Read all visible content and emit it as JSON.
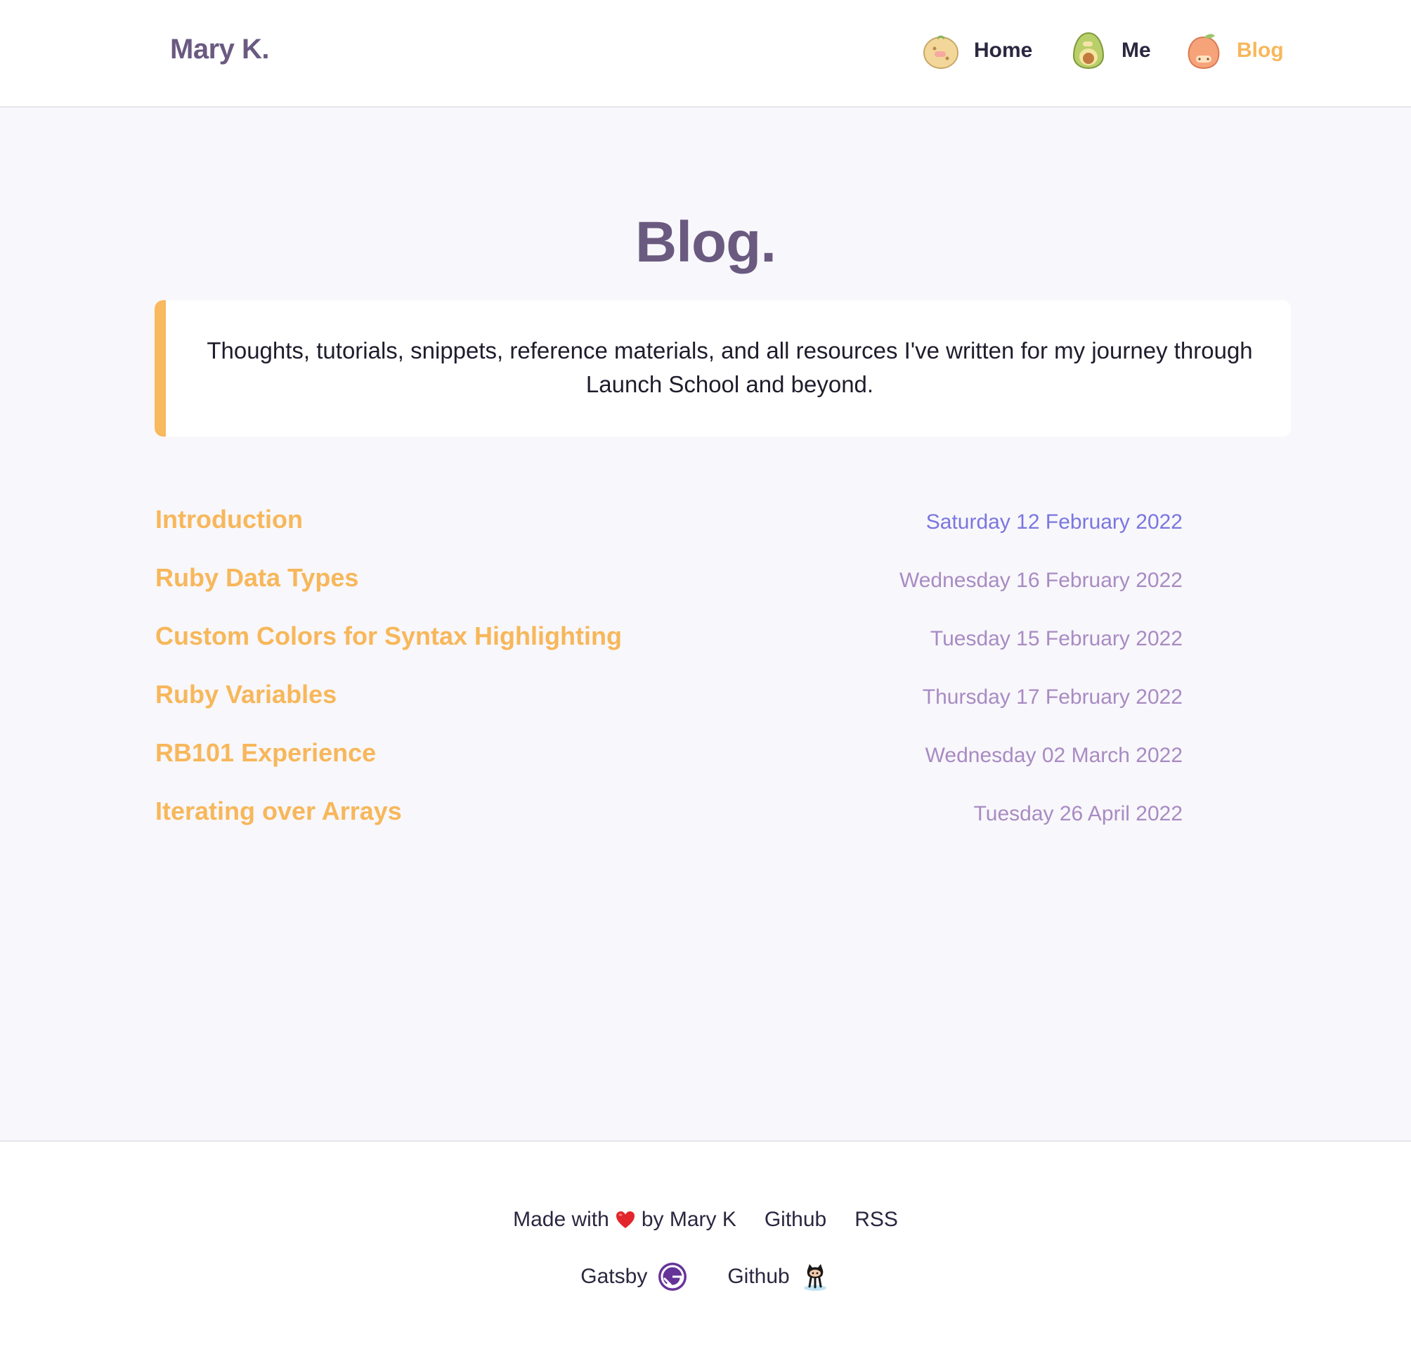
{
  "header": {
    "brand": "Mary K.",
    "nav": [
      {
        "label": "Home",
        "icon": "potato-icon",
        "active": false
      },
      {
        "label": "Me",
        "icon": "avocado-icon",
        "active": false
      },
      {
        "label": "Blog",
        "icon": "peach-icon",
        "active": true
      }
    ]
  },
  "page": {
    "title": "Blog.",
    "intro": "Thoughts, tutorials, snippets, reference materials, and all resources I've written for my journey through Launch School and beyond."
  },
  "posts": [
    {
      "title": "Introduction",
      "date": "Saturday 12 February 2022"
    },
    {
      "title": "Ruby Data Types",
      "date": "Wednesday 16 February 2022"
    },
    {
      "title": "Custom Colors for Syntax Highlighting",
      "date": "Tuesday 15 February 2022"
    },
    {
      "title": "Ruby Variables",
      "date": "Thursday 17 February 2022"
    },
    {
      "title": "RB101 Experience",
      "date": "Wednesday 02 March 2022"
    },
    {
      "title": "Iterating over Arrays",
      "date": "Tuesday 26 April 2022"
    }
  ],
  "footer": {
    "made_with_prefix": "Made with",
    "made_with_suffix": "by Mary K",
    "github_link": "Github",
    "rss_link": "RSS",
    "gatsby_badge": "Gatsby",
    "github_badge": "Github"
  },
  "colors": {
    "accent": "#f7b75a",
    "brand": "#6a5a80",
    "date": "#a88bc3",
    "date_highlight": "#7a76e0"
  }
}
